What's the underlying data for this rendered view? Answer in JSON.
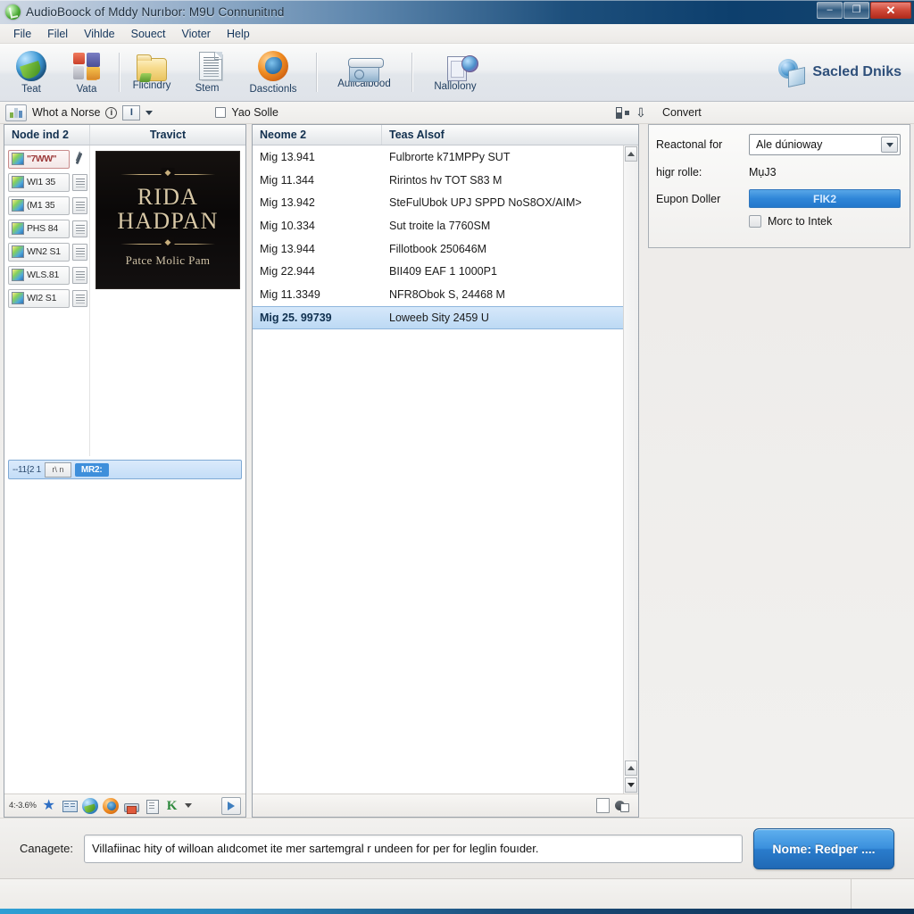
{
  "window": {
    "title": "AudioBoock of Mddy Nurıbor: M9U Connunitınd",
    "icon": "disc-icon",
    "minimize": "–",
    "maximize": "❐",
    "close": "✕"
  },
  "menu": {
    "items": [
      "File",
      "Filel",
      "Vihlde",
      "Souect",
      "Vioter",
      "Help"
    ]
  },
  "toolbar": {
    "buttons": [
      {
        "label": "Teat",
        "icon": "globe-icon"
      },
      {
        "label": "Vata",
        "icon": "blocks-icon"
      },
      {
        "label": "Flicindry",
        "icon": "folder-icon"
      },
      {
        "label": "Stem",
        "icon": "document-icon"
      },
      {
        "label": "Dasctionls",
        "icon": "firefox-icon"
      },
      {
        "label": "Auiicalbood",
        "icon": "archive-box-icon"
      },
      {
        "label": "Nallolony",
        "icon": "media-icon"
      }
    ],
    "brand": "Sacled Dniks",
    "brand_icon": "gear-disc-icon"
  },
  "subbar": {
    "chart_button_icon": "mini-chart-icon",
    "label": "Whot a Norse",
    "info_icon": "info-icon",
    "info_glyph": "i",
    "text_icon": "text-format-icon",
    "text_glyph": "I",
    "dropdown_icon": "chevron-down-icon",
    "checkbox_label": "Yao Solle",
    "tree_icon": "tree-view-icon",
    "download_icon": "download-arrow-icon",
    "convert_label": "Convert"
  },
  "left_panel": {
    "columns": [
      "Node ind 2",
      "Travict"
    ],
    "tree_items": [
      {
        "label": "\"7WW\"",
        "style": "red"
      },
      {
        "label": "WI1 35",
        "style": "normal"
      },
      {
        "label": "(M1 35",
        "style": "normal"
      },
      {
        "label": "PHS 84",
        "style": "normal"
      },
      {
        "label": "WN2 S1",
        "style": "normal"
      },
      {
        "label": "WLS.81",
        "style": "normal"
      },
      {
        "label": "WI2 S1",
        "style": "normal"
      }
    ],
    "cover": {
      "title_line1": "RIDA",
      "title_line2": "HADPAN",
      "subtitle": "Patce Molic Pam"
    },
    "selected_row": {
      "code": "--11{2 1",
      "mini_label": "r\\ n",
      "badge": "MR2:"
    },
    "footer": {
      "text": "4:-3.6%",
      "icons": [
        "star-icon",
        "grid-icon",
        "globe-icon",
        "firefox-icon",
        "print-icon",
        "page-icon",
        "k-icon",
        "chevron-down-icon",
        "export-icon"
      ]
    }
  },
  "center_panel": {
    "columns": [
      "Neome 2",
      "Teas Alsof"
    ],
    "rows": [
      {
        "name": "Mig 13.941",
        "info": "Fulbrorte k71MPPy SUT",
        "selected": false
      },
      {
        "name": "Mig 11.344",
        "info": "Ririntos hv TOT S83 M",
        "selected": false
      },
      {
        "name": "Mig 13.942",
        "info": "SteFulUbok UPJ SPPD NoS8OX/AIM>",
        "selected": false
      },
      {
        "name": "Mig 10.334",
        "info": "Sut troite la 7760SM",
        "selected": false
      },
      {
        "name": "Mig 13.944",
        "info": "Fillotbook 250646M",
        "selected": false
      },
      {
        "name": "Mig 22.944",
        "info": "BII409 EAF 1 1000P1",
        "selected": false
      },
      {
        "name": "Mig 11.3349",
        "info": "NFR8Obok S, 24468 M",
        "selected": false
      },
      {
        "name": "Mig 25. 99739",
        "info": "Loweeb Sity 2459 U",
        "selected": true
      }
    ],
    "scroll_up": "▲",
    "scroll_down": "▼",
    "footer_icons": [
      "file-icon",
      "gear-disc-icon"
    ]
  },
  "right_panel": {
    "title": "Convert",
    "format_label": "Reactonal for",
    "format_value": "Ale dúnioway",
    "dropdown_icon": "chevron-down-icon",
    "rate_label": "higr rolle:",
    "rate_value": "MụJ3",
    "coupon_label": "Eupon Doller",
    "coupon_button": "FlK2",
    "checkbox_label": "Morc to Intek"
  },
  "bottom": {
    "label": "Canagete:",
    "input_value": "Villafiinac hity of willoan alıdcomet ite mer sartemgral r undeen for per for leglin fouıder.",
    "input_placeholder": "Canagete",
    "button": "Nome: Redper ...."
  },
  "colors": {
    "accent": "#2f86d8",
    "title_dark": "#0d3f6d",
    "selection": "#bcd9f4",
    "brand": "#2e4f7a"
  }
}
